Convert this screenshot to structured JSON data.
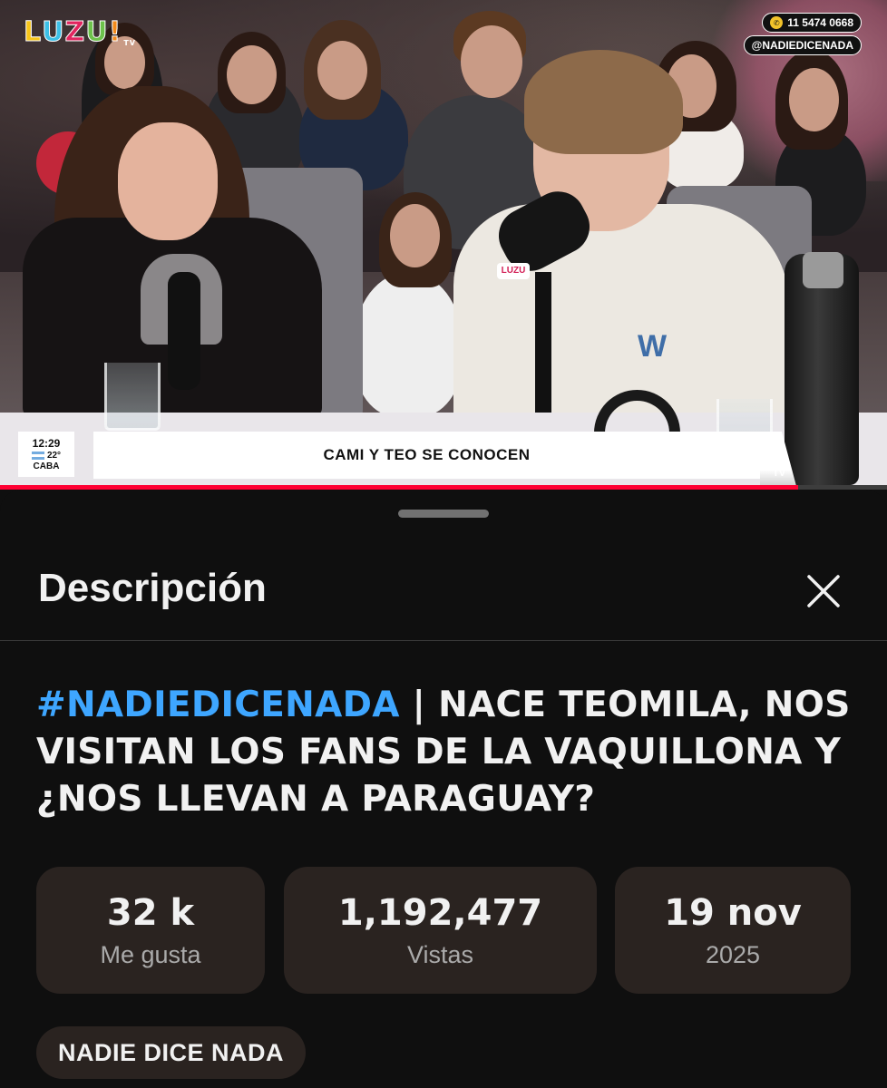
{
  "video": {
    "logo_letters": [
      "L",
      "U",
      "Z",
      "U",
      "!"
    ],
    "logo_colors": [
      "#f7c518",
      "#3cc0e8",
      "#e2255f",
      "#6dc24b",
      "#f28a1c"
    ],
    "logo_tv": "TV",
    "mic_label": "LUZU",
    "phone": "11 5474 0668",
    "handle": "@NADIEDICENADA",
    "clock": "12:29",
    "temperature": "22°",
    "city": "CABA",
    "headline": "CAMI Y TEO SE CONOCEN",
    "corner_tv": "TV",
    "shirt_logo": "W",
    "progress_fraction": 0.9
  },
  "sheet": {
    "title": "Descripción",
    "close_icon": "close-icon",
    "video_title_hashtag": "#NADIEDICENADA",
    "video_title_rest": " | NACE TEOMILA, NOS VISITAN LOS FANS DE LA VAQUILLONA Y ¿NOS LLEVAN A PARAGUAY?",
    "stats": [
      {
        "value": "32 k",
        "label": "Me gusta"
      },
      {
        "value": "1,192,477",
        "label": "Vistas"
      },
      {
        "value": "19 nov",
        "label": "2025"
      }
    ],
    "channel_chip": "NADIE DICE NADA"
  },
  "colors": {
    "accent_blue": "#3ea6ff",
    "progress_red": "#ff0033",
    "card_bg": "#2a2320"
  }
}
